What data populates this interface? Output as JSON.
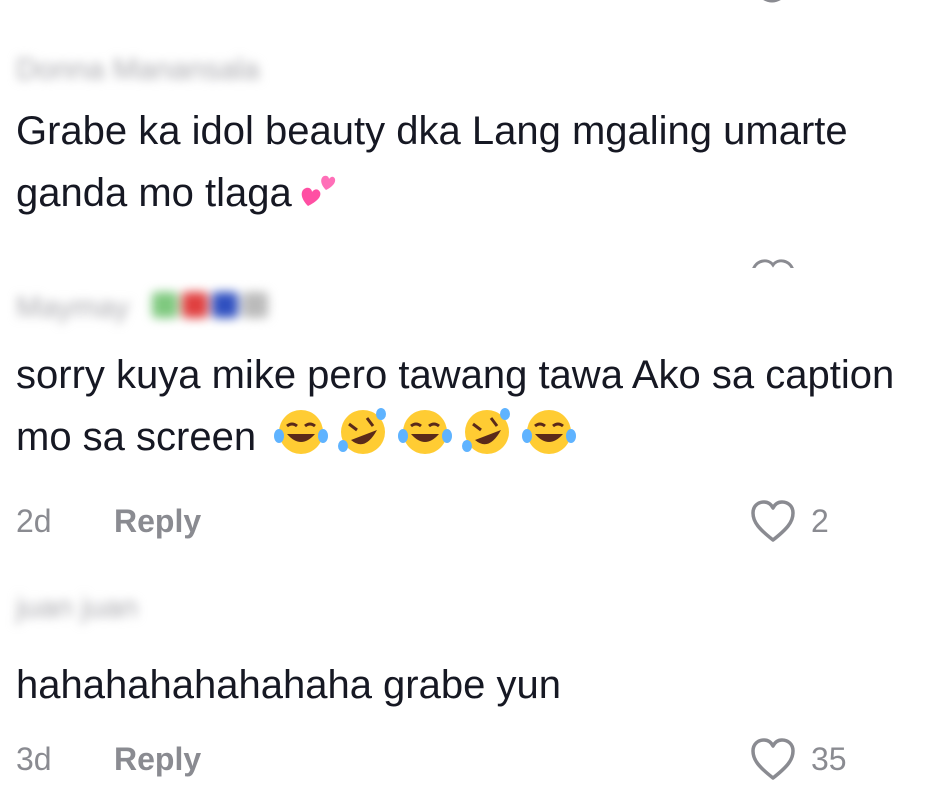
{
  "comments": [
    {
      "username": "Donna Manansala",
      "text": "Grabe ka idol beauty dka Lang mgaling umarte ganda mo tlaga",
      "emoji": "two-hearts"
    },
    {
      "username": "Maymay",
      "text": "sorry kuya mike pero tawang tawa Ako sa caption mo sa screen",
      "emojis": [
        "laughing-tears",
        "rolling-laughing",
        "laughing-tears",
        "rolling-laughing",
        "laughing-tears"
      ],
      "age": "2d",
      "reply_label": "Reply",
      "likes": "2"
    },
    {
      "username": "juan juan",
      "text": "hahahahahahahaha grabe yun",
      "age": "3d",
      "reply_label": "Reply",
      "likes": "35"
    }
  ],
  "colors": {
    "text": "#161823",
    "muted": "#8a8b91",
    "heart_outline": "#8a8b91",
    "emoji_pink": "#ff4fa3"
  }
}
